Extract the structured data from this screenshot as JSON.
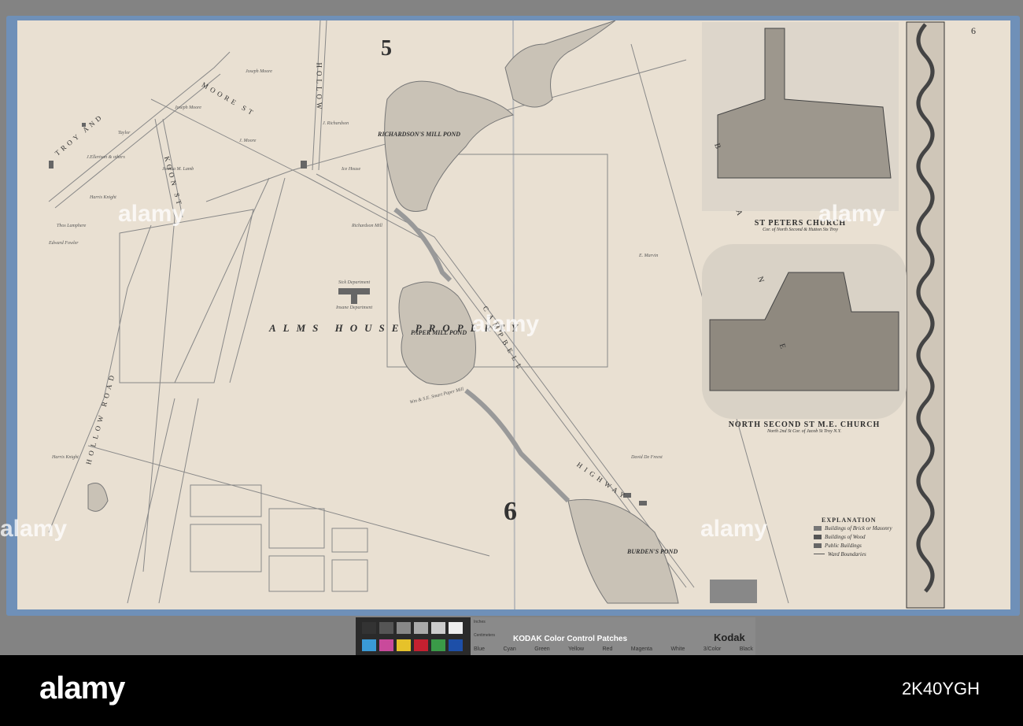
{
  "page_number": "6",
  "sheet_numbers": [
    "5",
    "6"
  ],
  "map_labels": {
    "alms_house": "ALMS HOUSE PROPERTY",
    "richardsons_pond": "RICHARDSON'S MILL POND",
    "paper_mill_pond": "PAPER MILL POND",
    "burdens_pond": "BURDEN'S POND",
    "troy_and": "TROY AND",
    "moore_st": "MOORE ST",
    "hollow": "HOLLOW",
    "koon_st": "KOON ST",
    "hollow_road": "HOLLOW ROAD",
    "campbell": "CAMPBELL",
    "highway": "HIGHWAY",
    "bane": "B A N E"
  },
  "owners": [
    "Joseph Moore",
    "Joseph Moore",
    "J. Moore",
    "Joshua M. Lamb",
    "Taylor",
    "J.Ellertson & others",
    "Harris Knight",
    "Thos Lamphere",
    "Edward Fowler",
    "J. Richardson",
    "Ice House",
    "Richardson Mill",
    "Insane Department",
    "Sick Department",
    "Wm & S.E. Smart Paper Mill",
    "David De Freest",
    "Harris Knight",
    "E. Marvin"
  ],
  "illustrations": [
    {
      "title": "ST PETERS CHURCH",
      "subtitle": "Cor. of North Second & Hutton Sts Troy"
    },
    {
      "title": "NORTH SECOND ST M.E. CHURCH",
      "subtitle": "North 2nd St Cor. of Jacob St Troy N.Y."
    }
  ],
  "legend": {
    "title": "EXPLANATION",
    "items": [
      "Buildings of Brick or Masonry",
      "Buildings of Wood",
      "Public Buildings",
      "Ward Boundaries"
    ]
  },
  "color_target": {
    "title": "KODAK Color Control Patches",
    "brand": "Kodak",
    "labels": [
      "Blue",
      "Cyan",
      "Green",
      "Yellow",
      "Red",
      "Magenta",
      "White",
      "3/Color",
      "Black"
    ],
    "units": [
      "Inches",
      "Centimeters"
    ]
  },
  "watermark": "alamy",
  "footer": {
    "logo": "alamy",
    "image_id": "2K40YGH"
  },
  "colors": {
    "paper": "#e9e0d2",
    "binding": "#6f90b8",
    "ink": "#333333"
  }
}
